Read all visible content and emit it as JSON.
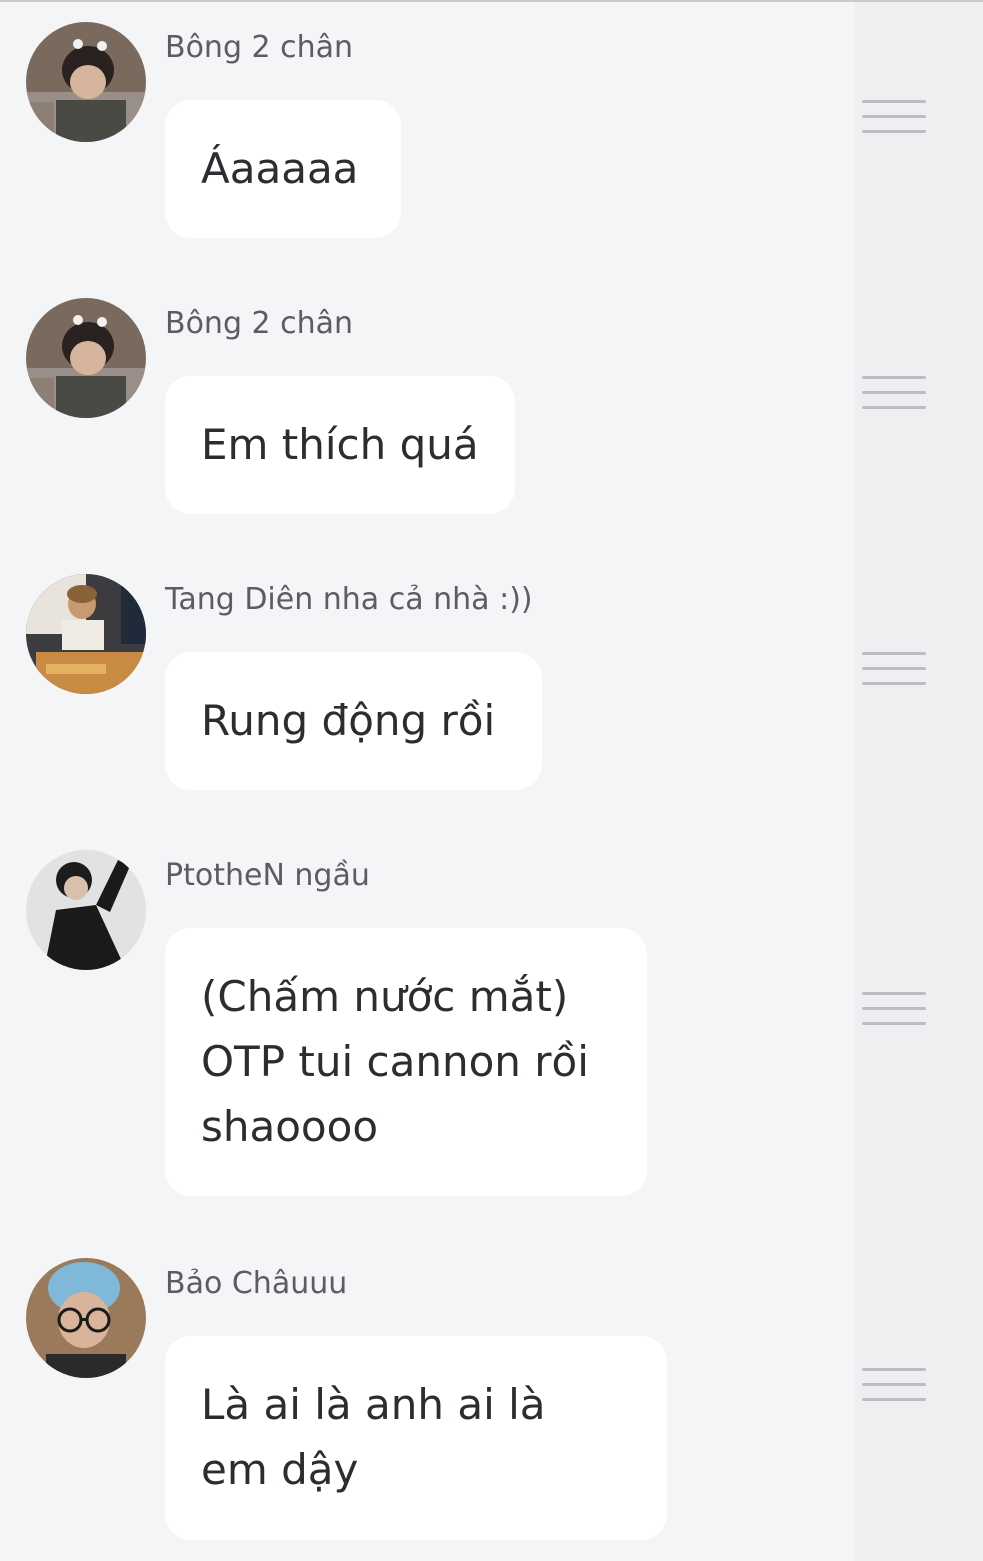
{
  "comments": [
    {
      "author": "Bông 2 chân",
      "avatar_icon": "user-avatar-photo",
      "text": "Áaaaaa",
      "menu_icon": "hamburger-menu-icon"
    },
    {
      "author": "Bông 2 chân",
      "avatar_icon": "user-avatar-photo",
      "text": "Em thích quá",
      "menu_icon": "hamburger-menu-icon"
    },
    {
      "author": "Tang Diên nha cả nhà :))",
      "avatar_icon": "user-avatar-photo",
      "text": "Rung động rồi",
      "menu_icon": "hamburger-menu-icon"
    },
    {
      "author": "PtotheN ngầu",
      "avatar_icon": "user-avatar-photo",
      "text": "(Chấm nước mắt)\nOTP tui cannon rồi\nshaoooo",
      "menu_icon": "hamburger-menu-icon"
    },
    {
      "author": "Bảo Châuuu",
      "avatar_icon": "user-avatar-photo",
      "text": "Là ai là anh ai là\nem dậy",
      "menu_icon": "hamburger-menu-icon"
    }
  ],
  "colors": {
    "background": "#f4f5f7",
    "side_strip": "#eeeff1",
    "bubble": "#ffffff",
    "text": "#2b2d31",
    "author": "#5b5d62",
    "menu_lines": "#bcbec2"
  }
}
